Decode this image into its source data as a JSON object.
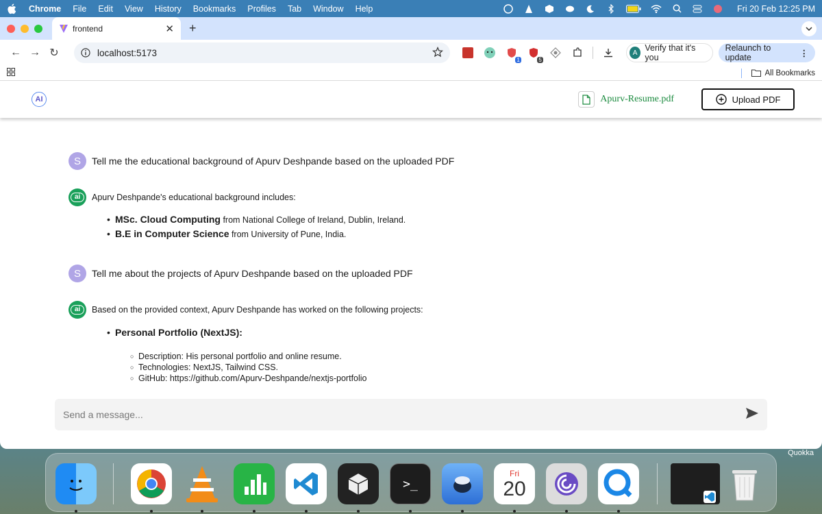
{
  "menubar": {
    "app": "Chrome",
    "items": [
      "File",
      "Edit",
      "View",
      "History",
      "Bookmarks",
      "Profiles",
      "Tab",
      "Window",
      "Help"
    ],
    "datetime": "Fri 20 Feb  12:25 PM"
  },
  "browser": {
    "tab_title": "frontend",
    "url": "localhost:5173",
    "extension_badges": [
      "1",
      "5"
    ],
    "profile_initial": "A",
    "verify_label": "Verify that it's you",
    "relaunch_label": "Relaunch to update",
    "all_bookmarks_label": "All Bookmarks"
  },
  "app": {
    "logo_text": "AI",
    "file_name": "Apurv-Resume.pdf",
    "upload_label": "Upload PDF",
    "input_placeholder": "Send a message..."
  },
  "chat": {
    "user_initial": "S",
    "ai_label": "ai",
    "msg1": "Tell me the educational background of Apurv Deshpande based on the uploaded PDF",
    "resp1_intro": "Apurv Deshpande's educational background includes:",
    "resp1_items": [
      {
        "bold": "MSc. Cloud Computing",
        "rest": " from National College of Ireland, Dublin, Ireland."
      },
      {
        "bold": "B.E in Computer Science",
        "rest": " from University of Pune, India."
      }
    ],
    "msg2": "Tell me about the projects of Apurv Deshpande based on the uploaded PDF",
    "resp2_intro": "Based on the provided context, Apurv Deshpande has worked on the following projects:",
    "resp2_project": "Personal Portfolio (NextJS):",
    "resp2_details": [
      "Description: His personal portfolio and online resume.",
      "Technologies: NextJS, Tailwind CSS.",
      "GitHub: https://github.com/Apurv-Deshpande/nextjs-portfolio"
    ]
  },
  "dock": {
    "calendar_day": "Fri",
    "calendar_date": "20",
    "quokka_label": "Quokka",
    "items": [
      "finder-icon",
      "chrome-icon",
      "vlc-icon",
      "numbers-icon",
      "vscode-icon",
      "unity-icon",
      "terminal-icon",
      "preview-icon",
      "calendar-icon",
      "torrent-icon",
      "quicktime-icon",
      "vscode-window-thumb",
      "trash-icon"
    ]
  },
  "colors": {
    "menubar": "#3a7fb6",
    "tabstrip": "#d3e3fd",
    "file_green": "#1a8a3e",
    "ai_avatar": "#1aa05a",
    "user_avatar": "#b0a5e6"
  }
}
